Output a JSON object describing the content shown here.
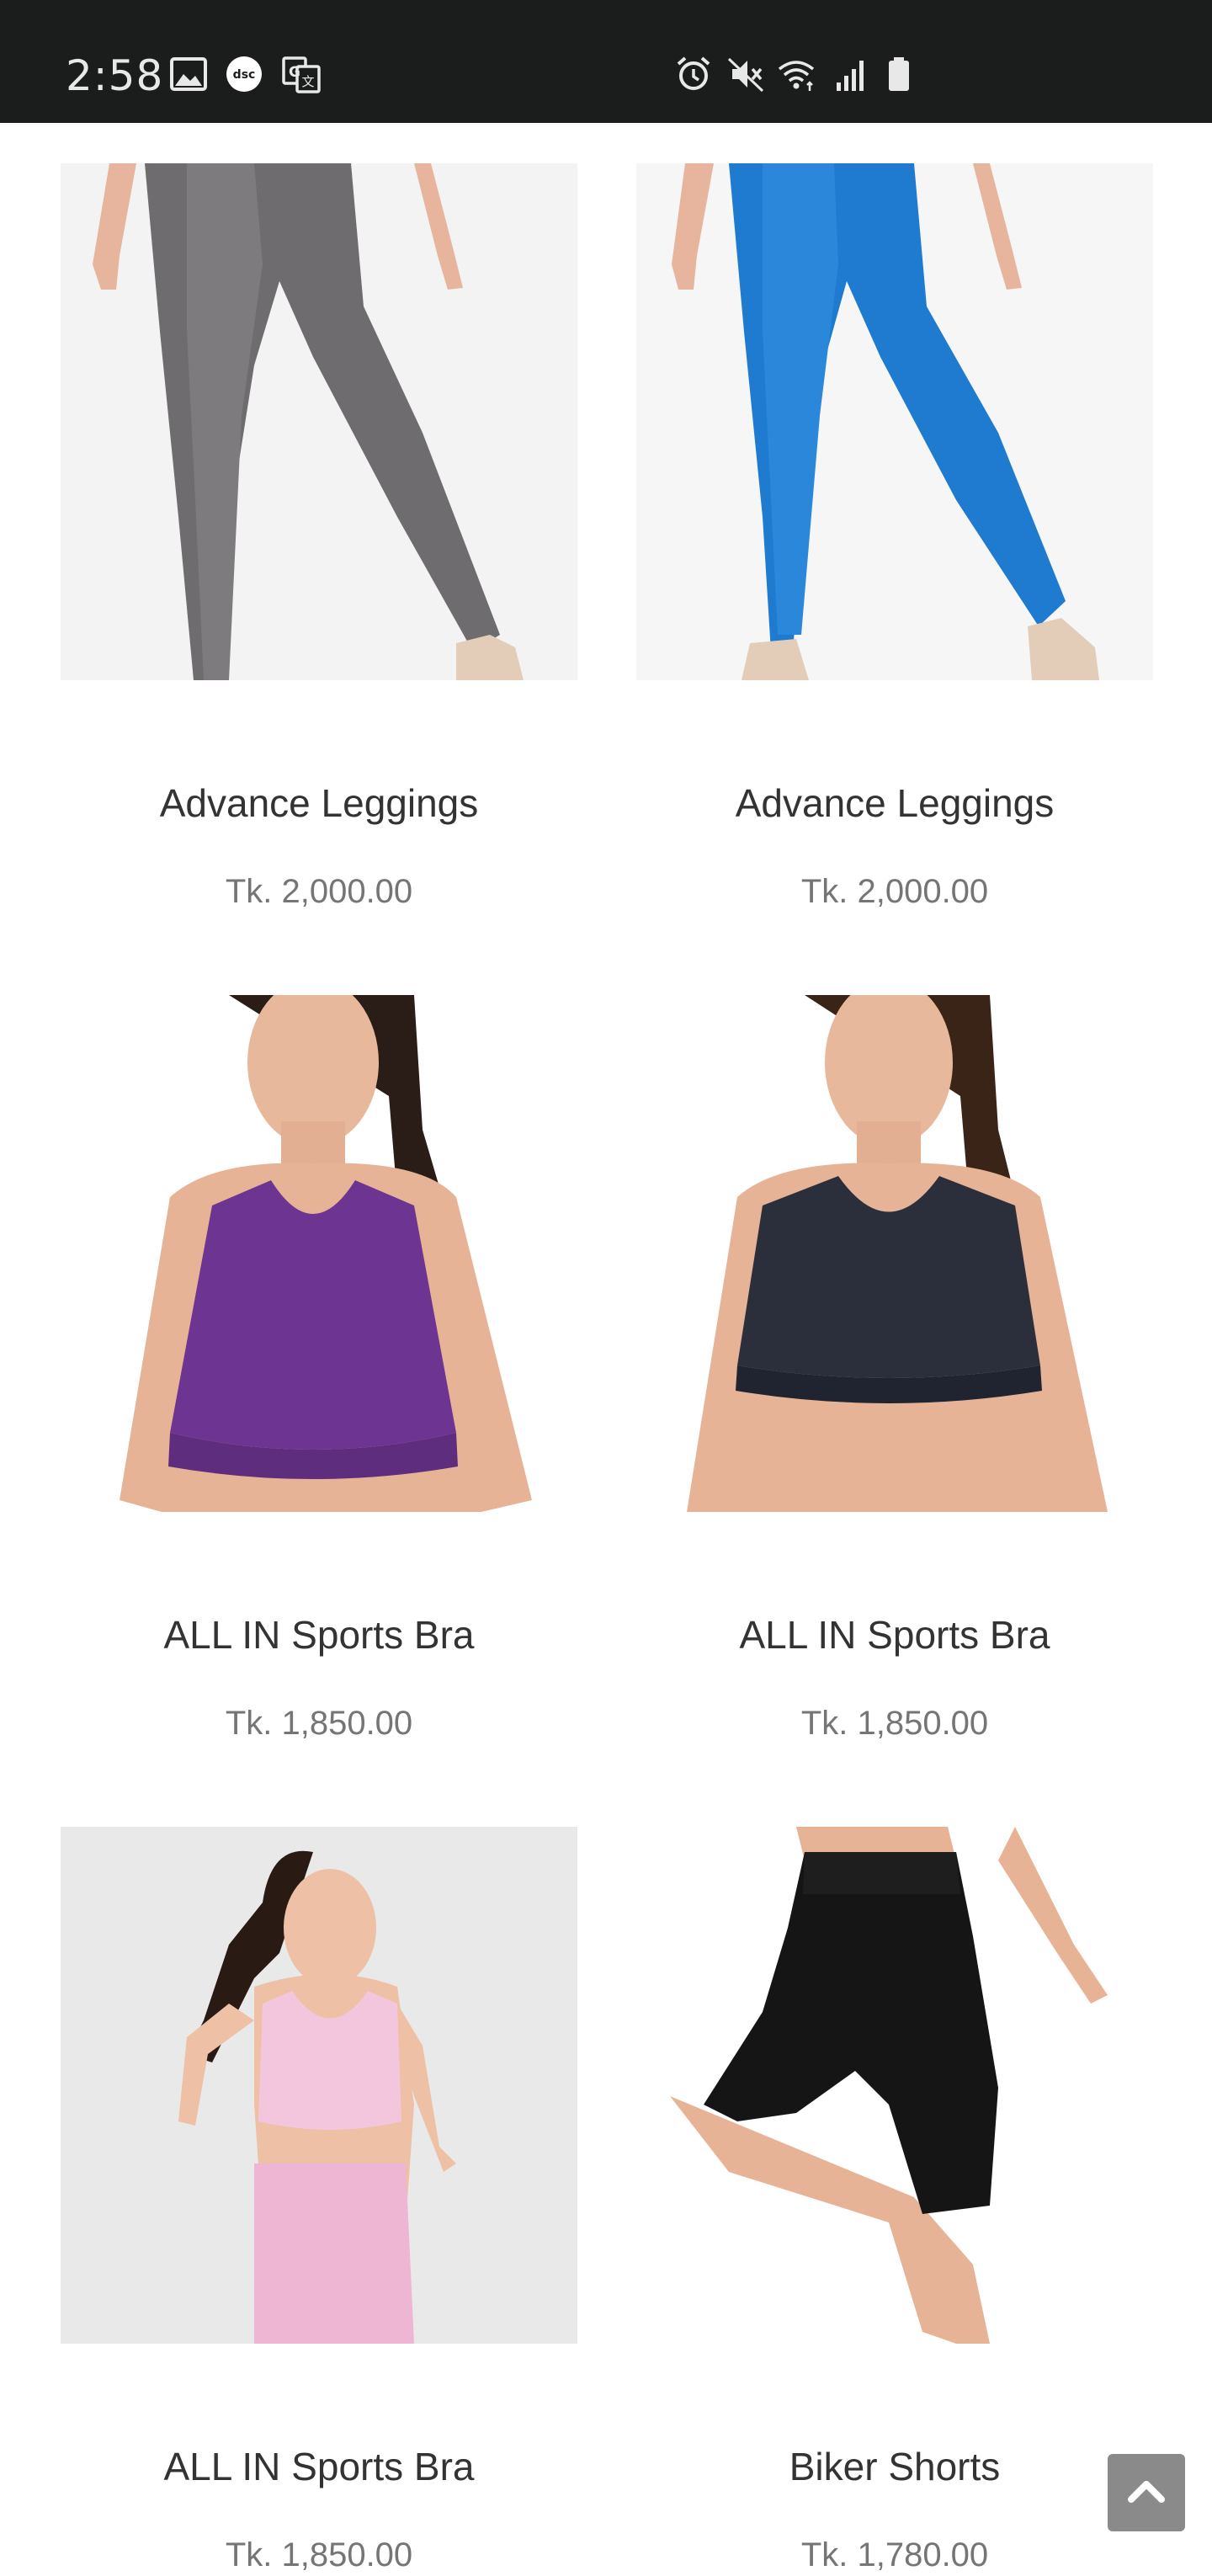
{
  "status_bar": {
    "time": "2:58",
    "left_icons": [
      "gallery-icon",
      "app-notification-icon",
      "translate-icon"
    ],
    "right_icons": [
      "alarm-icon",
      "mute-icon",
      "wifi-icon",
      "signal-icon",
      "battery-icon"
    ]
  },
  "products": [
    {
      "name": "Advance Leggings",
      "price": "Tk. 2,000.00",
      "color": "#6e6c6f"
    },
    {
      "name": "Advance Leggings",
      "price": "Tk. 2,000.00",
      "color": "#1f7bd0"
    },
    {
      "name": "ALL IN Sports Bra",
      "price": "Tk. 1,850.00",
      "color": "#6d3591"
    },
    {
      "name": "ALL IN Sports Bra",
      "price": "Tk. 1,850.00",
      "color": "#2a2f3b"
    },
    {
      "name": "ALL IN Sports Bra",
      "price": "Tk. 1,850.00",
      "color": "#efb6d4"
    },
    {
      "name": "Biker Shorts",
      "price": "Tk. 1,780.00",
      "color": "#151515"
    }
  ],
  "back_to_top_icon": "chevron-up-icon"
}
